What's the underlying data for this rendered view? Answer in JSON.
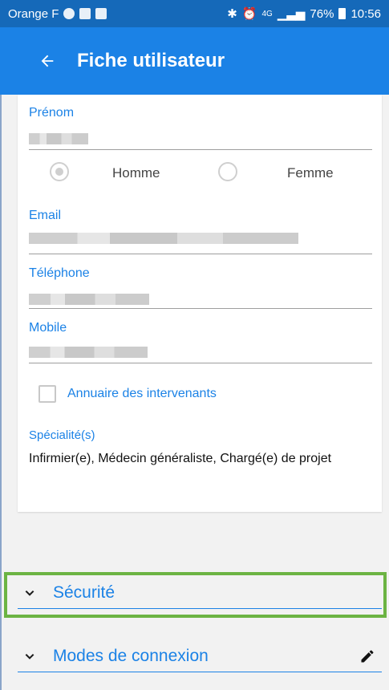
{
  "status_bar": {
    "carrier": "Orange F",
    "right_text": "76%",
    "network": "4G",
    "time": "10:56"
  },
  "app_bar": {
    "title": "Fiche utilisateur",
    "back_icon": "arrow-left-icon"
  },
  "form": {
    "prenom": {
      "label": "Prénom",
      "value": ""
    },
    "gender": {
      "options": [
        "Homme",
        "Femme"
      ],
      "selected": "Homme"
    },
    "email": {
      "label": "Email",
      "value": ""
    },
    "telephone": {
      "label": "Téléphone",
      "value": ""
    },
    "mobile": {
      "label": "Mobile",
      "value": ""
    },
    "annuaire": {
      "label": "Annuaire des intervenants",
      "checked": false
    },
    "specialites": {
      "label": "Spécialité(s)",
      "value": "Infirmier(e), Médecin généraliste, Chargé(e) de projet"
    }
  },
  "sections": [
    {
      "title": "Sécurité",
      "icon": "chevron-down-icon"
    },
    {
      "title": "Modes de connexion",
      "icon": "chevron-down-icon",
      "action_icon": "pencil-icon"
    }
  ],
  "colors": {
    "accent": "#1b82e6",
    "status_bar": "#1569b9",
    "highlight": "#6cb443"
  }
}
